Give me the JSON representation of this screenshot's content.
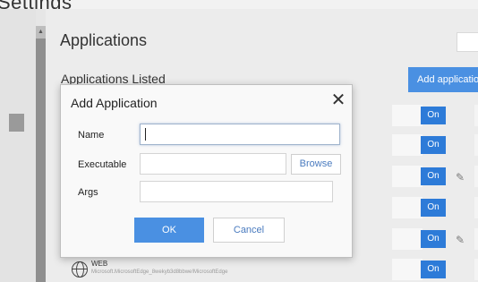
{
  "page": {
    "title": "Settings"
  },
  "left_nav": {
    "scroll_up_glyph": "▲"
  },
  "main": {
    "title": "Applications",
    "list_heading": "Applications Listed",
    "add_button_label": "Add application"
  },
  "app_rows": [
    {
      "toggle": "On",
      "editable": false
    },
    {
      "toggle": "On",
      "editable": false
    },
    {
      "toggle": "On",
      "editable": true
    },
    {
      "toggle": "On",
      "editable": false
    },
    {
      "toggle": "On",
      "editable": true
    },
    {
      "toggle": "On",
      "editable": false
    }
  ],
  "web_entry": {
    "icon": "globe-icon",
    "label": "WEB",
    "path": "Microsoft.MicrosoftEdge_8wekyb3d8bbwe!MicrosoftEdge"
  },
  "dialog": {
    "title": "Add Application",
    "close_glyph": "✕",
    "fields": {
      "name": {
        "label": "Name",
        "value": ""
      },
      "executable": {
        "label": "Executable",
        "value": ""
      },
      "args": {
        "label": "Args",
        "value": ""
      }
    },
    "browse_label": "Browse",
    "ok_label": "OK",
    "cancel_label": "Cancel"
  },
  "colors": {
    "accent": "#4a90e2",
    "toggle_on": "#2d7bd8"
  }
}
